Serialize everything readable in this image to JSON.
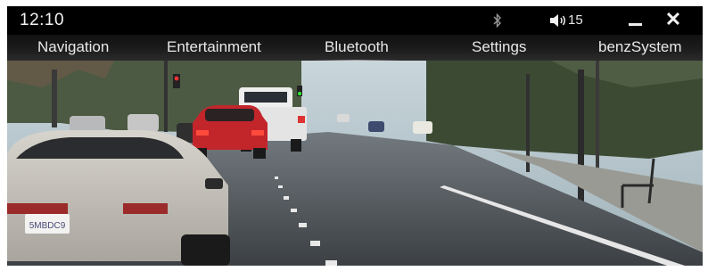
{
  "status": {
    "time": "12:10",
    "volume_level": "15",
    "icons": [
      "bluetooth-icon",
      "volume-icon",
      "minimize-icon",
      "close-icon"
    ],
    "close_glyph": "✕"
  },
  "nav": {
    "tabs": [
      {
        "label": "Navigation"
      },
      {
        "label": "Entertainment"
      },
      {
        "label": "Bluetooth"
      },
      {
        "label": "Settings"
      },
      {
        "label": "benzSystem"
      }
    ],
    "active_tab": "Bluetooth"
  },
  "camera": {
    "plate_text": "5MBDC9"
  },
  "colors": {
    "bar_background": "#000000",
    "text": "#e8e8e8"
  }
}
